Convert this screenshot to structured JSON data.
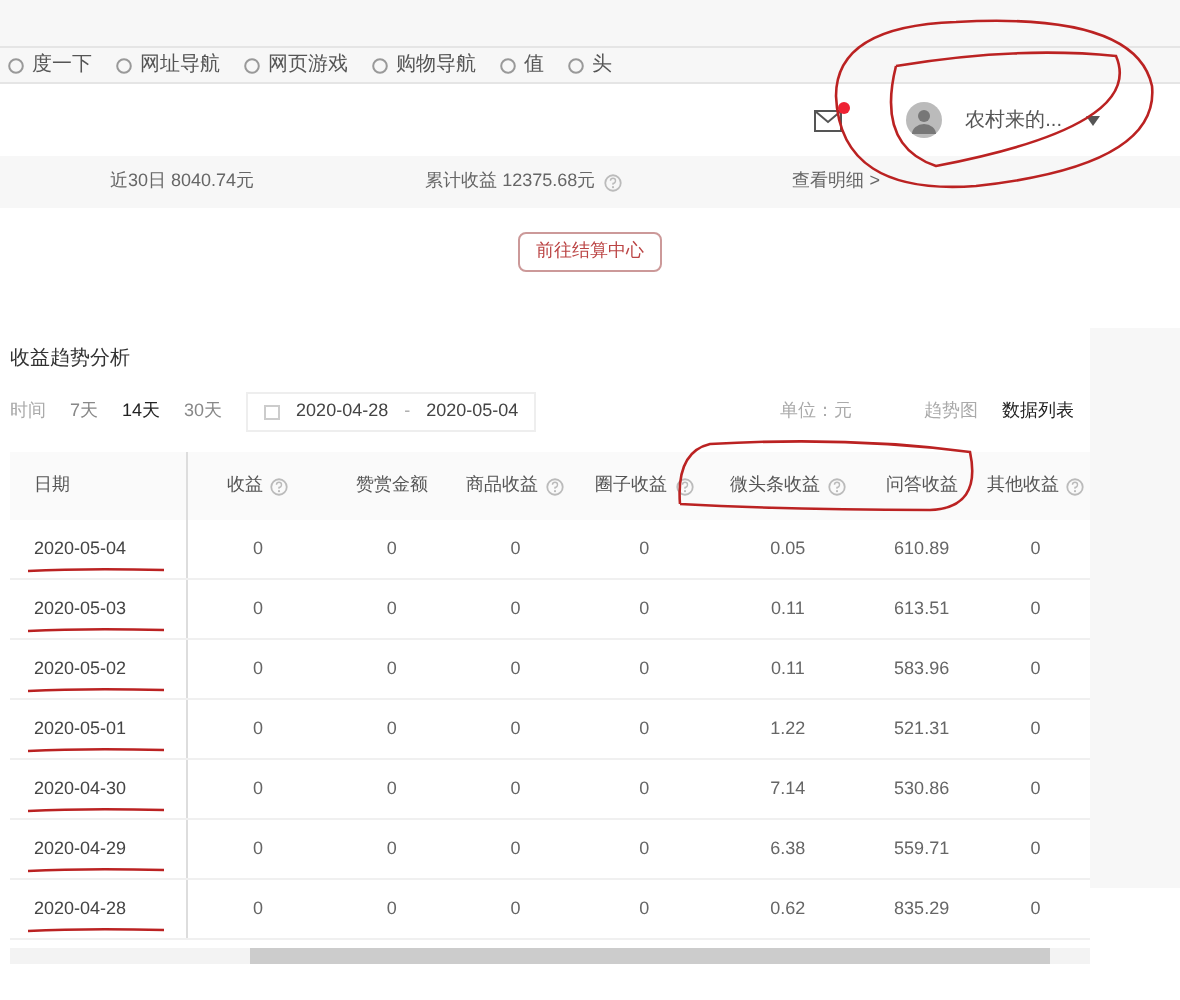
{
  "bookmarks": [
    {
      "label": "度一下"
    },
    {
      "label": "网址导航"
    },
    {
      "label": "网页游戏"
    },
    {
      "label": "购物导航"
    },
    {
      "label": "值"
    },
    {
      "label": "头"
    }
  ],
  "header": {
    "username": "农村来的...",
    "unread": true
  },
  "summary": {
    "recent": "近30日 8040.74元",
    "total": "累计收益 12375.68元",
    "details": "查看明细 >"
  },
  "settle_button": "前往结算中心",
  "section_title": "收益趋势分析",
  "filters": {
    "label": "时间",
    "ranges": [
      {
        "label": "7天",
        "selected": false
      },
      {
        "label": "14天",
        "selected": true
      },
      {
        "label": "30天",
        "selected": false
      }
    ],
    "start": "2020-04-28",
    "separator": "-",
    "end": "2020-05-04",
    "unit": "单位：元",
    "views": [
      {
        "label": "趋势图",
        "selected": false
      },
      {
        "label": "数据列表",
        "selected": true
      }
    ]
  },
  "table": {
    "columns": [
      {
        "label": "日期",
        "help": false
      },
      {
        "label": "收益",
        "help": true
      },
      {
        "label": "赞赏金额",
        "help": false
      },
      {
        "label": "商品收益",
        "help": true
      },
      {
        "label": "圈子收益",
        "help": true
      },
      {
        "label": "微头条收益",
        "help": true
      },
      {
        "label": "问答收益",
        "help": false
      },
      {
        "label": "其他收益",
        "help": true
      }
    ],
    "rows": [
      [
        "2020-05-04",
        "0",
        "0",
        "0",
        "0",
        "0.05",
        "610.89",
        "0"
      ],
      [
        "2020-05-03",
        "0",
        "0",
        "0",
        "0",
        "0.11",
        "613.51",
        "0"
      ],
      [
        "2020-05-02",
        "0",
        "0",
        "0",
        "0",
        "0.11",
        "583.96",
        "0"
      ],
      [
        "2020-05-01",
        "0",
        "0",
        "0",
        "0",
        "1.22",
        "521.31",
        "0"
      ],
      [
        "2020-04-30",
        "0",
        "0",
        "0",
        "0",
        "7.14",
        "530.86",
        "0"
      ],
      [
        "2020-04-29",
        "0",
        "0",
        "0",
        "0",
        "6.38",
        "559.71",
        "0"
      ],
      [
        "2020-04-28",
        "0",
        "0",
        "0",
        "0",
        "0.62",
        "835.29",
        "0"
      ]
    ]
  }
}
